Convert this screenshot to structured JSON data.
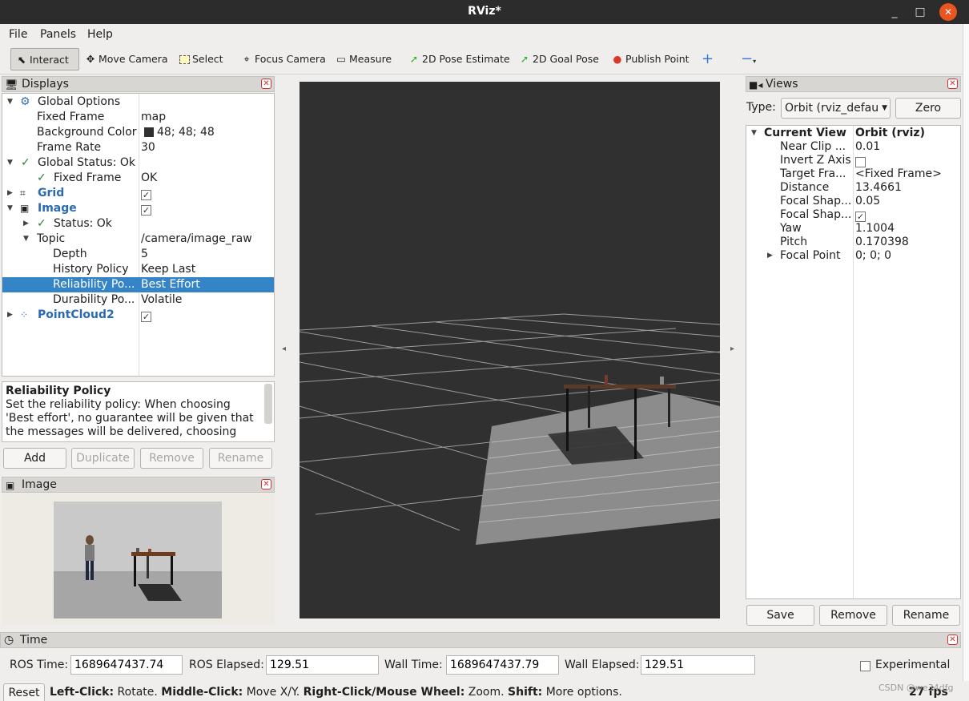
{
  "window": {
    "title": "RViz*",
    "minimize": "_",
    "maximize": "□",
    "close": "✕"
  },
  "menu": [
    "File",
    "Panels",
    "Help"
  ],
  "toolbar": {
    "interact": "Interact",
    "move_camera": "Move Camera",
    "select": "Select",
    "focus_camera": "Focus Camera",
    "measure": "Measure",
    "pose_estimate": "2D Pose Estimate",
    "goal_pose": "2D Goal Pose",
    "publish_point": "Publish Point"
  },
  "displays": {
    "title": "Displays",
    "rows": {
      "global_options": "Global Options",
      "fixed_frame": "Fixed Frame",
      "fixed_frame_val": "map",
      "background_color": "Background Color",
      "background_color_val": "48; 48; 48",
      "frame_rate": "Frame Rate",
      "frame_rate_val": "30",
      "global_status": "Global Status: Ok",
      "gs_fixed_frame": "Fixed Frame",
      "gs_fixed_frame_val": "OK",
      "grid": "Grid",
      "image": "Image",
      "status": "Status: Ok",
      "topic": "Topic",
      "topic_val": "/camera/image_raw",
      "depth": "Depth",
      "depth_val": "5",
      "history": "History Policy",
      "history_val": "Keep Last",
      "reliability": "Reliability Po...",
      "reliability_val": "Best Effort",
      "durability": "Durability Po...",
      "durability_val": "Volatile",
      "pointcloud": "PointCloud2"
    },
    "description_title": "Reliability Policy",
    "description": "Set the reliability policy: When choosing 'Best effort', no guarantee will be given that the messages will be delivered, choosing",
    "buttons": {
      "add": "Add",
      "duplicate": "Duplicate",
      "remove": "Remove",
      "rename": "Rename"
    }
  },
  "image_panel": {
    "title": "Image"
  },
  "views": {
    "title": "Views",
    "type_label": "Type:",
    "type_value": "Orbit (rviz_defau",
    "zero": "Zero",
    "rows": {
      "current_view": "Current View",
      "current_view_val": "Orbit (rviz)",
      "near_clip": "Near Clip ...",
      "near_clip_val": "0.01",
      "invert_z": "Invert Z Axis",
      "target_frame": "Target Fra...",
      "target_frame_val": "<Fixed Frame>",
      "distance": "Distance",
      "distance_val": "13.4661",
      "focal_shape1": "Focal Shap...",
      "focal_shape1_val": "0.05",
      "focal_shape2": "Focal Shap...",
      "yaw": "Yaw",
      "yaw_val": "1.1004",
      "pitch": "Pitch",
      "pitch_val": "0.170398",
      "focal_point": "Focal Point",
      "focal_point_val": "0; 0; 0"
    },
    "buttons": {
      "save": "Save",
      "remove": "Remove",
      "rename": "Rename"
    }
  },
  "time": {
    "title": "Time",
    "ros_time_label": "ROS Time:",
    "ros_time": "1689647437.74",
    "ros_elapsed_label": "ROS Elapsed:",
    "ros_elapsed": "129.51",
    "wall_time_label": "Wall Time:",
    "wall_time": "1689647437.79",
    "wall_elapsed_label": "Wall Elapsed:",
    "wall_elapsed": "129.51",
    "experimental": "Experimental"
  },
  "status": {
    "reset": "Reset",
    "left_click": "Left-Click:",
    "left_click_desc": " Rotate. ",
    "middle_click": "Middle-Click:",
    "middle_click_desc": " Move X/Y. ",
    "right_click": "Right-Click/Mouse Wheel:",
    "right_click_desc": " Zoom. ",
    "shift": "Shift:",
    "shift_desc": " More options.",
    "fps": "27 fps",
    "watermark": "CSDN @we34dfg"
  },
  "colors": {
    "selection": "#3584c8",
    "viewport_bg": "#303030",
    "accent": "#e95420"
  },
  "icons": [
    "cursor-icon",
    "move-camera-icon",
    "select-icon",
    "focus-icon",
    "measure-icon",
    "pose-arrow-icon",
    "goal-arrow-icon",
    "map-pin-icon",
    "plus-icon",
    "minus-icon",
    "monitor-icon",
    "camera-icon",
    "clock-icon",
    "gear-icon",
    "check-icon"
  ]
}
